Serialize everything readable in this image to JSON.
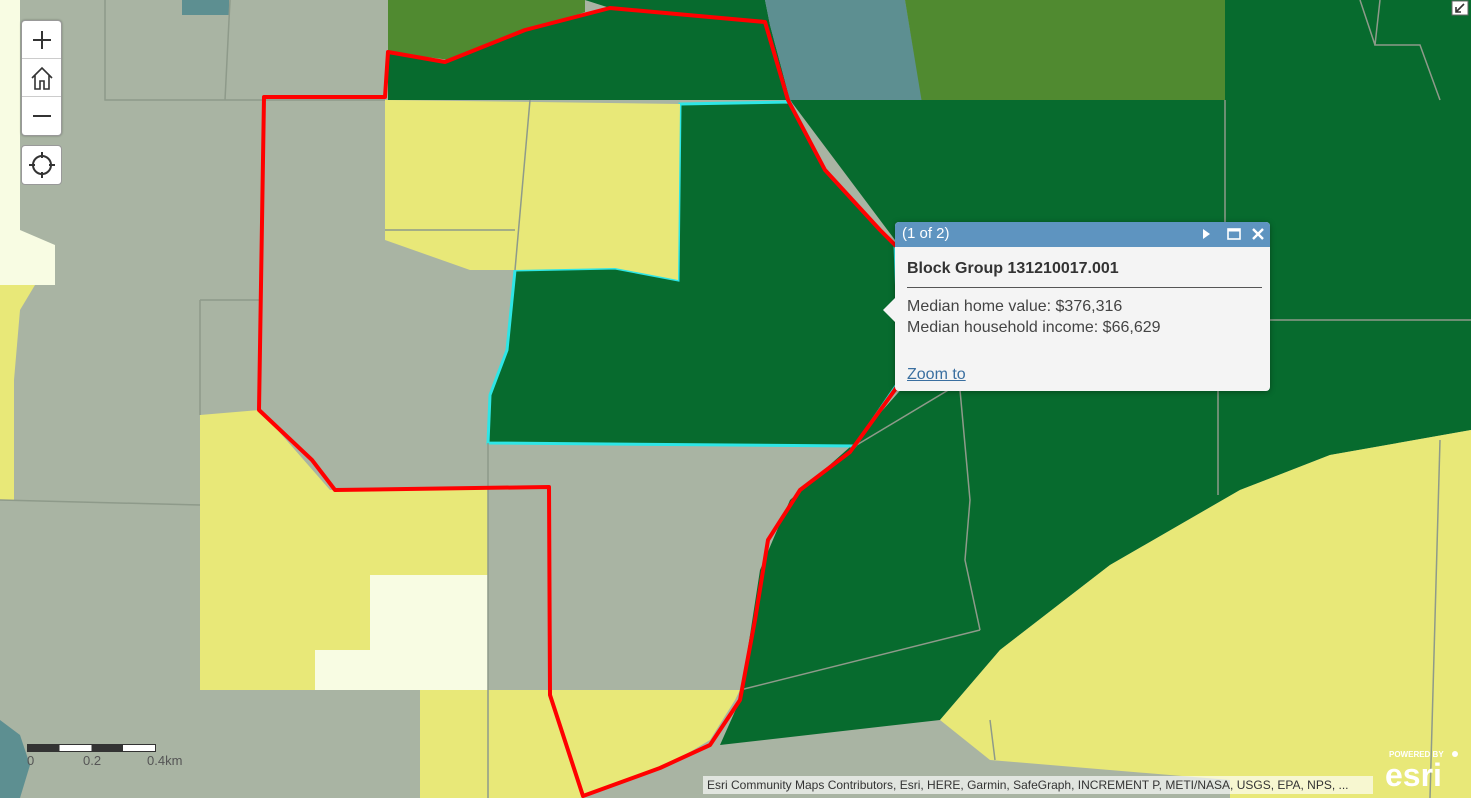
{
  "map": {
    "colors": {
      "gray": "#a9b4a3",
      "dark_green": "#076b2e",
      "olive_green": "#508a30",
      "yellow": "#e8e878",
      "pale_yellow": "#f8fce3",
      "teal": "#5d8f91",
      "boundary_red": "#ff0000",
      "selection_cyan": "#2ee6e6"
    }
  },
  "controls": {
    "zoom_in_icon": "plus-icon",
    "home_icon": "home-icon",
    "zoom_out_icon": "minus-icon",
    "locate_icon": "locate-crosshair-icon",
    "expand_icon": "expand-arrow-icon"
  },
  "popup": {
    "count": "(1 of 2)",
    "title": "Block Group 131210017.001",
    "lines": [
      "Median home value: $376,316",
      "Median household income: $66,629"
    ],
    "zoom_link": "Zoom to",
    "header_color": "#5e94c0"
  },
  "scale": {
    "labels": [
      "0",
      "0.2",
      "0.4km"
    ]
  },
  "attribution": "Esri Community Maps Contributors, Esri, HERE, Garmin, SafeGraph, INCREMENT P, METI/NASA, USGS, EPA, NPS, ...",
  "logo": {
    "powered_by": "POWERED BY",
    "brand": "esri"
  }
}
